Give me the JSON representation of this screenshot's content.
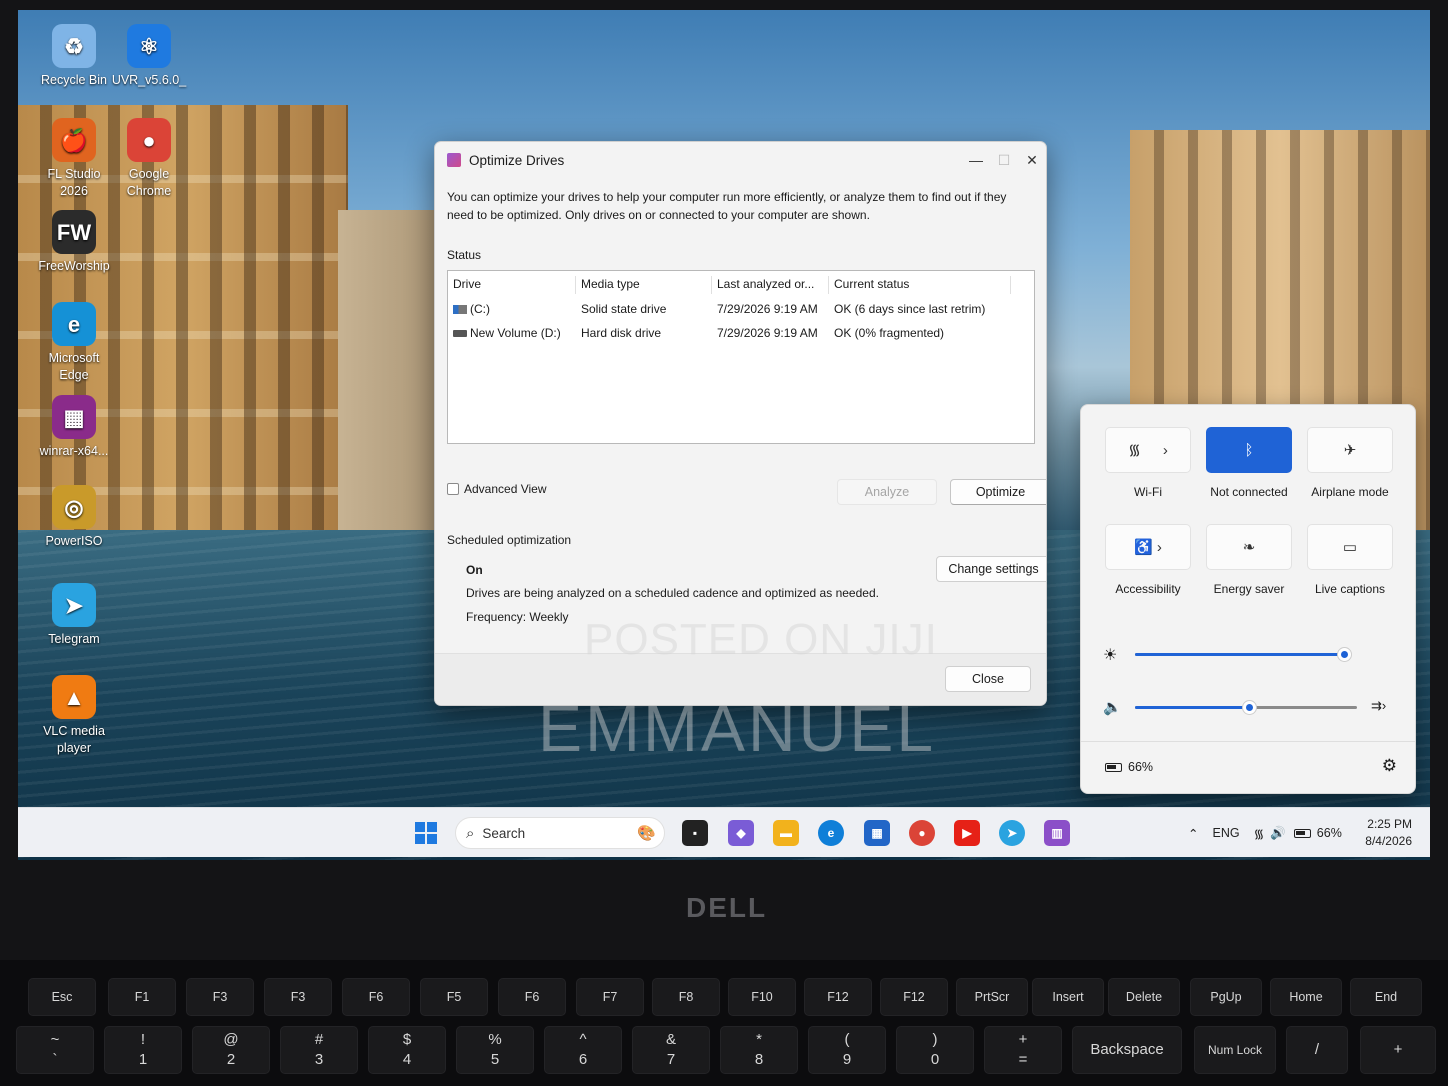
{
  "desktop": {
    "icons": [
      {
        "label": "Recycle Bin",
        "glyph": "♻"
      },
      {
        "label": "UVR_v5.6.0_",
        "glyph": "⚛"
      },
      {
        "label": "FL Studio 2026",
        "glyph": "🍎"
      },
      {
        "label": "Google Chrome",
        "glyph": "●"
      },
      {
        "label": "FreeWorship",
        "glyph": "FW"
      },
      {
        "label": "Microsoft Edge",
        "glyph": "e"
      },
      {
        "label": "winrar-x64...",
        "glyph": "▦"
      },
      {
        "label": "PowerISO",
        "glyph": "◎"
      },
      {
        "label": "Telegram",
        "glyph": "➤"
      },
      {
        "label": "VLC media player",
        "glyph": "▲"
      }
    ]
  },
  "window": {
    "title": "Optimize Drives",
    "description": "You can optimize your drives to help your computer run more efficiently, or analyze them to find out if they need to be optimized. Only drives on or connected to your computer are shown.",
    "status_label": "Status",
    "columns": [
      "Drive",
      "Media type",
      "Last analyzed or...",
      "Current status"
    ],
    "drives": [
      {
        "drive": "(C:)",
        "media": "Solid state drive",
        "last": "7/29/2026 9:19 AM",
        "status": "OK (6 days since last retrim)"
      },
      {
        "drive": "New Volume (D:)",
        "media": "Hard disk drive",
        "last": "7/29/2026 9:19 AM",
        "status": "OK (0% fragmented)"
      }
    ],
    "advanced_view": "Advanced View",
    "analyze_label": "Analyze",
    "optimize_label": "Optimize",
    "scheduled_label": "Scheduled optimization",
    "scheduled_state": "On",
    "scheduled_desc": "Drives are being analyzed on a scheduled cadence and optimized as needed.",
    "frequency": "Frequency: Weekly",
    "change_settings_label": "Change settings",
    "close_label": "Close"
  },
  "watermark": {
    "line1": "POSTED ON JIJI",
    "line2": "EMMANUEL"
  },
  "quick_settings": {
    "tiles": [
      {
        "label": "Wi-Fi",
        "icon": "wifi-icon",
        "active": false
      },
      {
        "label": "Not connected",
        "icon": "bluetooth-icon",
        "active": true
      },
      {
        "label": "Airplane mode",
        "icon": "airplane-icon",
        "active": false
      },
      {
        "label": "Accessibility",
        "icon": "accessibility-icon",
        "active": false
      },
      {
        "label": "Energy saver",
        "icon": "leaf-icon",
        "active": false
      },
      {
        "label": "Live captions",
        "icon": "captions-icon",
        "active": false
      }
    ],
    "brightness_fraction": 0.97,
    "volume_fraction": 0.52,
    "battery": "66%",
    "accent": "#1f63d6"
  },
  "taskbar": {
    "search_placeholder": "Search",
    "language": "ENG",
    "battery": "66%",
    "time": "2:25 PM",
    "date": "8/4/2026"
  },
  "bezel": {
    "logo": "DELL"
  },
  "keyboard": {
    "function_row": [
      "Esc",
      "F1",
      "F3",
      "F3",
      "F6",
      "F5",
      "F6",
      "F7",
      "F8",
      "F10",
      "F12",
      "F12",
      "PrtScr",
      "Insert",
      "Delete",
      "PgUp",
      "Home",
      "End"
    ],
    "number_row": [
      {
        "top": "~",
        "bottom": "`"
      },
      {
        "top": "!",
        "bottom": "1"
      },
      {
        "top": "@",
        "bottom": "2"
      },
      {
        "top": "#",
        "bottom": "3"
      },
      {
        "top": "$",
        "bottom": "4"
      },
      {
        "top": "%",
        "bottom": "5"
      },
      {
        "top": "^",
        "bottom": "6"
      },
      {
        "top": "&",
        "bottom": "7"
      },
      {
        "top": "*",
        "bottom": "8"
      },
      {
        "top": "(",
        "bottom": "9"
      },
      {
        "top": ")",
        "bottom": "0"
      },
      {
        "top": "+",
        "bottom": "="
      }
    ],
    "backspace": "Backspace",
    "numlock": "Num Lock",
    "slash": "/",
    "plus": "+"
  }
}
